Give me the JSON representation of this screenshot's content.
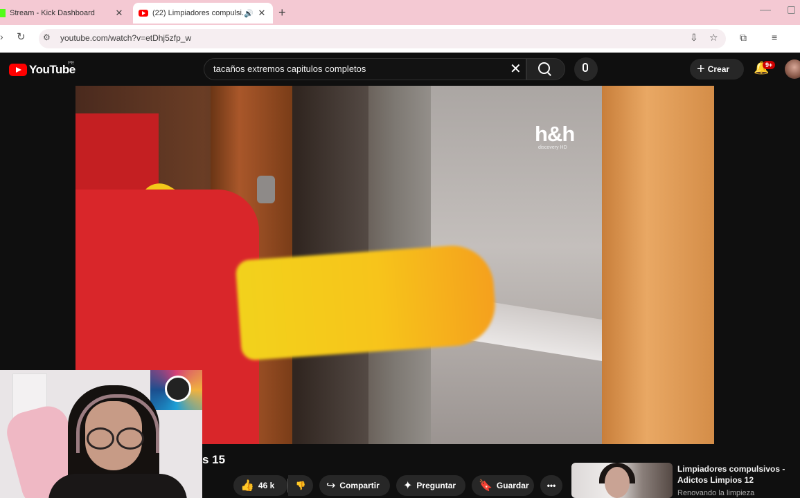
{
  "browser": {
    "tabs": [
      {
        "title": "Stream - Kick Dashboard"
      },
      {
        "title": "(22) Limpiadores compulsi..."
      }
    ],
    "new_tab": "+",
    "url": "youtube.com/watch?v=etDhj5zfp_w"
  },
  "youtube": {
    "logo_text": "YouTube",
    "country": "PE",
    "search_query": "tacaños extremos capitulos completos",
    "create_label": "Crear",
    "notifications_badge": "9+"
  },
  "video": {
    "watermark": "h&h",
    "watermark_sub": "discovery HD",
    "title_fragment": "s 15"
  },
  "actions": {
    "like_count": "46 k",
    "share_label": "Compartir",
    "ask_label": "Preguntar",
    "save_label": "Guardar"
  },
  "recommended": {
    "title": "Limpiadores compulsivos - Adictos Limpios 12",
    "channel": "Renovando la limpieza"
  },
  "colors": {
    "tab_strip": "#f4c9d3",
    "yt_bg": "#0f0f0f",
    "yt_red": "#ff0000",
    "badge_red": "#cc0000"
  }
}
